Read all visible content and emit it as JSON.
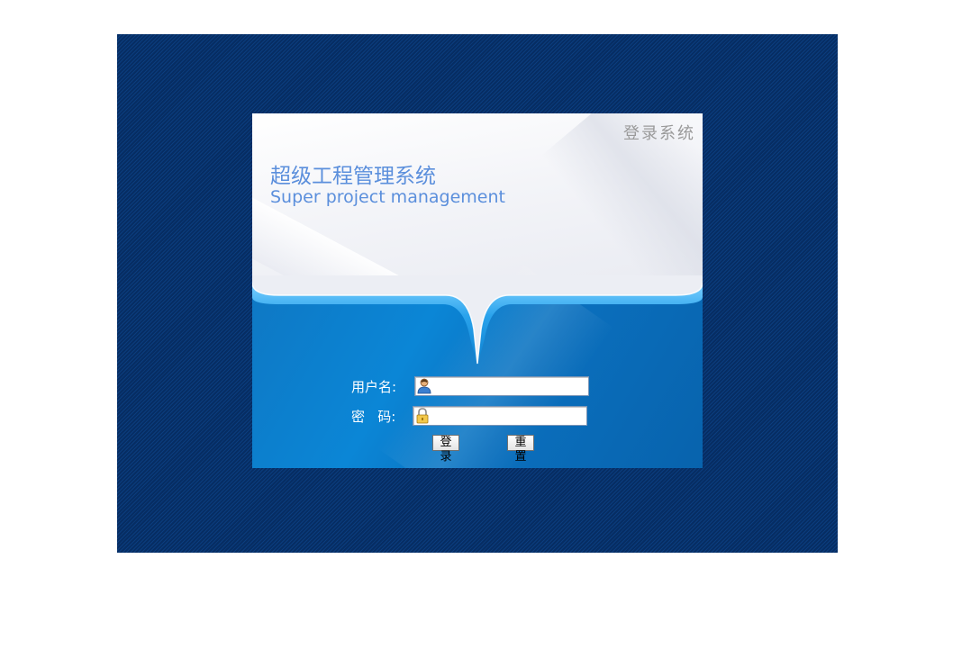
{
  "card": {
    "corner_title": "登录系统",
    "system_name_cn": "超级工程管理系统",
    "system_name_en": "Super project management"
  },
  "form": {
    "username_label": "用户名:",
    "username_value": "",
    "password_label": "密   码:",
    "password_value": "",
    "login_button": "登录",
    "reset_button": "重置"
  },
  "icons": {
    "username": "user-icon",
    "password": "lock-icon"
  },
  "colors": {
    "background_pattern": "#0a3a78",
    "title_text": "#5b8fdc",
    "panel_blue": "#0b86d6",
    "corner_title": "#9a9a9a"
  }
}
